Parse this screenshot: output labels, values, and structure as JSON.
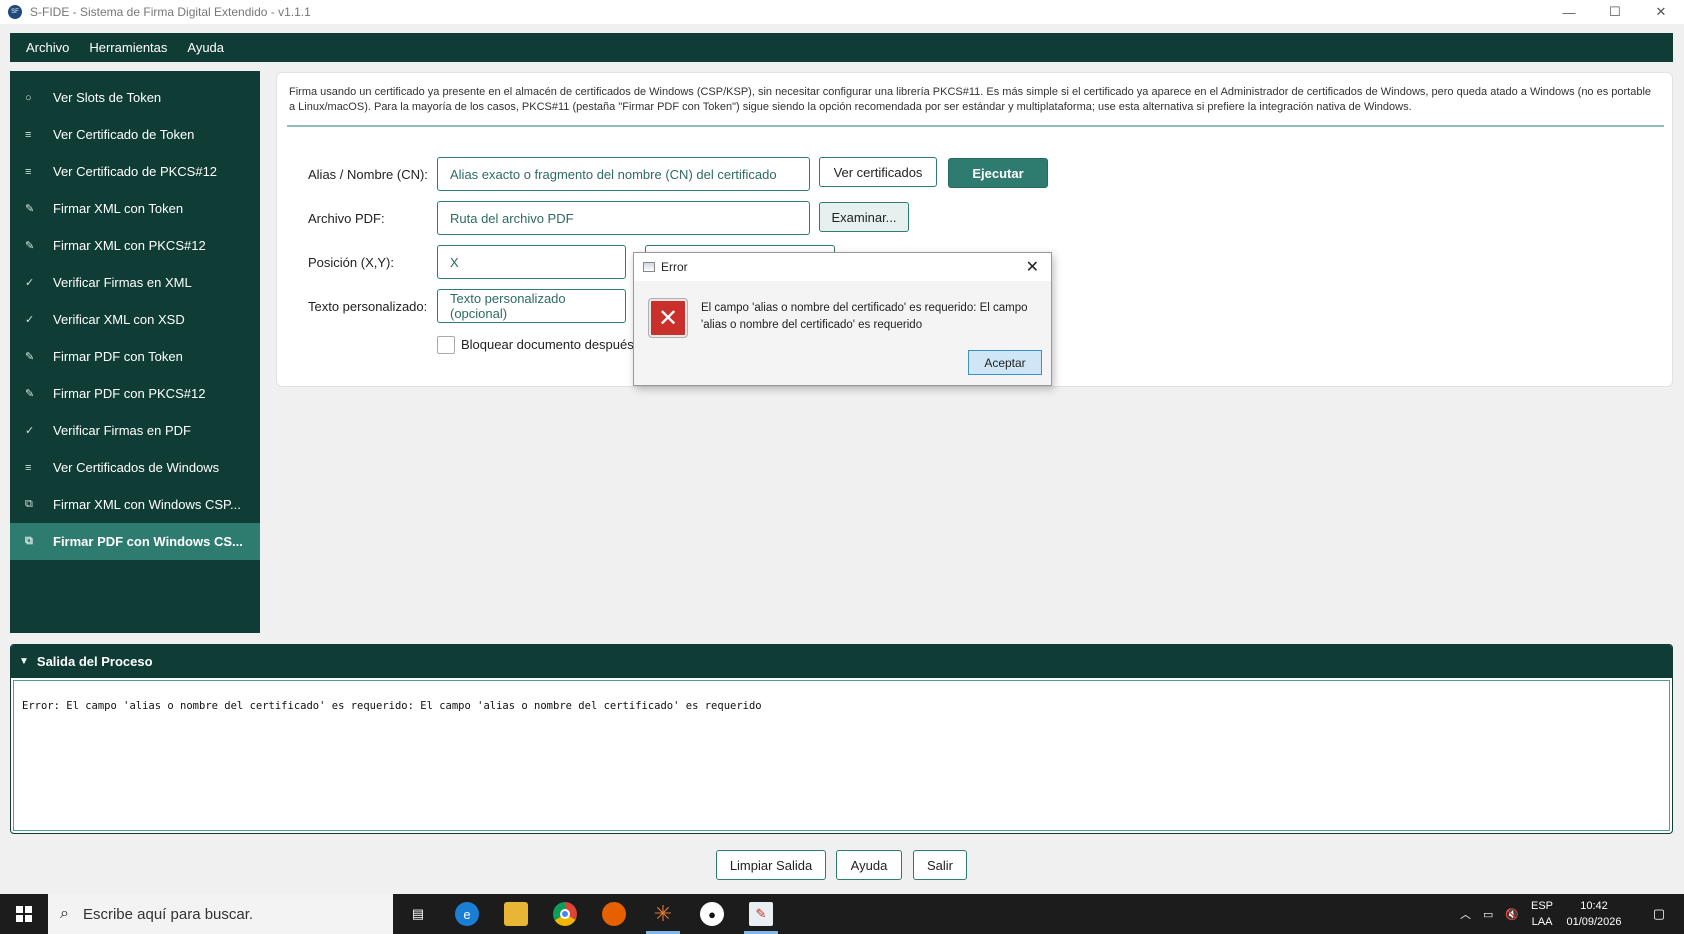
{
  "window": {
    "title": "S-FIDE - Sistema de Firma Digital Extendido - v1.1.1",
    "icon_text": "SF",
    "minimize": "—",
    "maximize": "☐",
    "close": "✕"
  },
  "menubar": [
    "Archivo",
    "Herramientas",
    "Ayuda"
  ],
  "sidebar": {
    "items": [
      {
        "icon": "○",
        "label": "Ver Slots de Token"
      },
      {
        "icon": "≡",
        "label": "Ver Certificado de Token"
      },
      {
        "icon": "≡",
        "label": "Ver Certificado de PKCS#12"
      },
      {
        "icon": "✎",
        "label": "Firmar XML con Token"
      },
      {
        "icon": "✎",
        "label": "Firmar XML con PKCS#12"
      },
      {
        "icon": "✓",
        "label": "Verificar Firmas en XML"
      },
      {
        "icon": "✓",
        "label": "Verificar XML con XSD"
      },
      {
        "icon": "✎",
        "label": "Firmar PDF con Token"
      },
      {
        "icon": "✎",
        "label": "Firmar PDF con PKCS#12"
      },
      {
        "icon": "✓",
        "label": "Verificar Firmas en PDF"
      },
      {
        "icon": "≡",
        "label": "Ver Certificados de Windows"
      },
      {
        "icon": "⧉",
        "label": "Firmar XML con Windows CSP..."
      },
      {
        "icon": "⧉",
        "label": "Firmar PDF con Windows CS..."
      }
    ]
  },
  "panel": {
    "description": "Firma usando un certificado ya presente en el almacén de certificados de Windows (CSP/KSP), sin necesitar configurar una librería PKCS#11. Es más simple si el certificado ya aparece en el Administrador de certificados de Windows, pero queda atado a Windows (no es portable a Linux/macOS). Para la mayoría de los casos, PKCS#11 (pestaña \"Firmar PDF con Token\") sigue siendo la opción recomendada por ser estándar y multiplataforma; use esta alternativa si prefiere la integración nativa de Windows.",
    "alias_label": "Alias / Nombre (CN):",
    "alias_placeholder": "Alias exacto o fragmento del nombre (CN) del certificado",
    "ver_certificados": "Ver certificados",
    "ejecutar": "Ejecutar",
    "pdf_label": "Archivo PDF:",
    "pdf_placeholder": "Ruta del archivo PDF",
    "examinar": "Examinar...",
    "pos_label": "Posición (X,Y):",
    "pos_x_placeholder": "X",
    "texto_label": "Texto personalizado:",
    "texto_placeholder": "Texto personalizado (opcional)",
    "bloquear_label": "Bloquear documento después"
  },
  "output": {
    "title": "Salida del Proceso",
    "text": "Error: El campo 'alias o nombre del certificado' es requerido: El campo 'alias o nombre del certificado' es requerido"
  },
  "bottom_buttons": {
    "limpiar": "Limpiar Salida",
    "ayuda": "Ayuda",
    "salir": "Salir"
  },
  "dialog": {
    "title": "Error",
    "message": "El campo 'alias o nombre del certificado' es requerido: El campo 'alias o nombre del certificado' es requerido",
    "ok": "Aceptar"
  },
  "taskbar": {
    "search_placeholder": "Escribe aquí para buscar.",
    "lang_top": "ESP",
    "lang_bottom": "LAA",
    "time": "10:42",
    "date": "01/09/2026"
  },
  "colors": {
    "brand_dark": "#0f3d36",
    "brand_accent": "#2e7b70",
    "error_red": "#c9302c"
  }
}
